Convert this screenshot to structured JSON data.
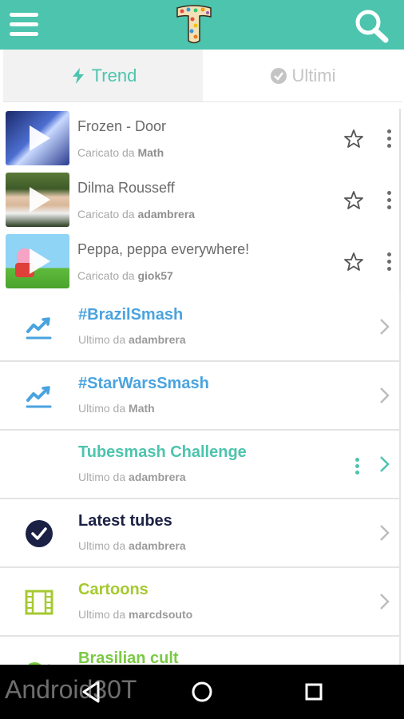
{
  "colors": {
    "accent": "#4dc4ad",
    "blue_link": "#4aa3df",
    "navy": "#1b2145",
    "lime": "#a6c931"
  },
  "tabs": [
    {
      "label": "Trend",
      "icon": "lightning-icon",
      "active": true
    },
    {
      "label": "Ultimi",
      "icon": "check-circle-icon",
      "active": false
    }
  ],
  "videos": [
    {
      "title": "Frozen - Door",
      "prefix": "Caricato da",
      "user": "Math"
    },
    {
      "title": "Dilma Rousseff",
      "prefix": "Caricato da",
      "user": "adambrera"
    },
    {
      "title": "Peppa, peppa everywhere!",
      "prefix": "Caricato da",
      "user": "giok57"
    }
  ],
  "channels": [
    {
      "title": "#BrazilSmash",
      "prefix": "Ultimo da",
      "user": "adambrera",
      "icon": "trending-chart-icon",
      "color": "#4aa3df"
    },
    {
      "title": "#StarWarsSmash",
      "prefix": "Ultimo da",
      "user": "Math",
      "icon": "trending-chart-icon",
      "color": "#4aa3df"
    },
    {
      "title": "Tubesmash Challenge",
      "prefix": "Ultimo da",
      "user": "adambrera",
      "icon": "",
      "color": "#4dc4ad"
    },
    {
      "title": "Latest tubes",
      "prefix": "Ultimo da",
      "user": "adambrera",
      "icon": "check-circle-icon",
      "color": "#1b2145"
    },
    {
      "title": "Cartoons",
      "prefix": "Ultimo da",
      "user": "marcdsouto",
      "icon": "film-strip-icon",
      "color": "#a6c931"
    },
    {
      "title": "Brasilian cult",
      "prefix": "",
      "user": "",
      "icon": "flag-icon",
      "color": "#7ac943"
    }
  ],
  "watermark": "Android30T"
}
